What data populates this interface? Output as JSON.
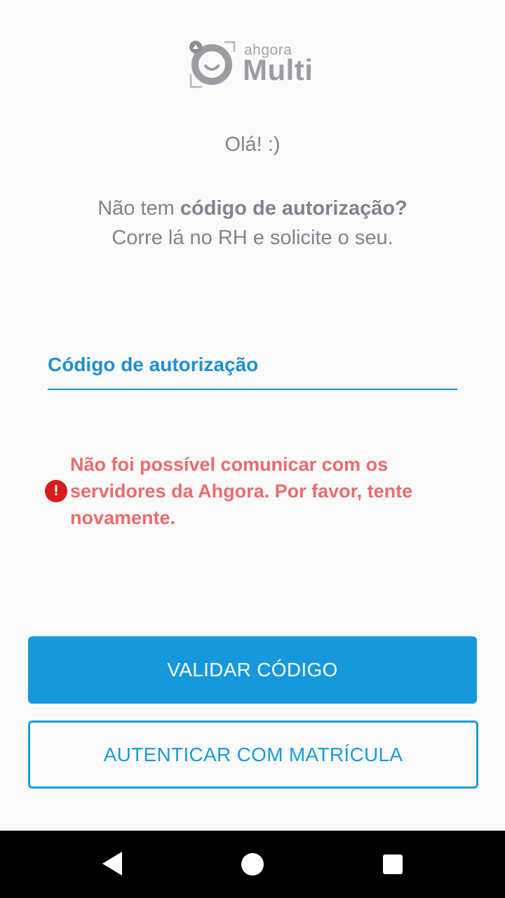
{
  "logo": {
    "small_text": "ahgora",
    "big_text": "Multi",
    "icon": "ahgora-smile-logo-icon"
  },
  "greeting": "Olá! :)",
  "info": {
    "line1_prefix": "Não tem ",
    "line1_bold": "código de autorização?",
    "line2": "Corre lá no RH e solicite o seu."
  },
  "auth_field": {
    "label": "Código de autorização",
    "value": ""
  },
  "error": {
    "icon": "error-exclamation-icon",
    "message": "Não foi possível comunicar com os servidores da Ahgora. Por favor, tente novamente."
  },
  "buttons": {
    "validate": "VALIDAR CÓDIGO",
    "matricula": "AUTENTICAR COM MATRÍCULA"
  },
  "colors": {
    "primary": "#1599dc",
    "error": "#ec6b6b",
    "error_icon": "#d81b1b",
    "muted_text": "#80838f"
  },
  "navbar": {
    "back_icon": "nav-back-icon",
    "home_icon": "nav-home-icon",
    "recents_icon": "nav-recents-icon"
  }
}
